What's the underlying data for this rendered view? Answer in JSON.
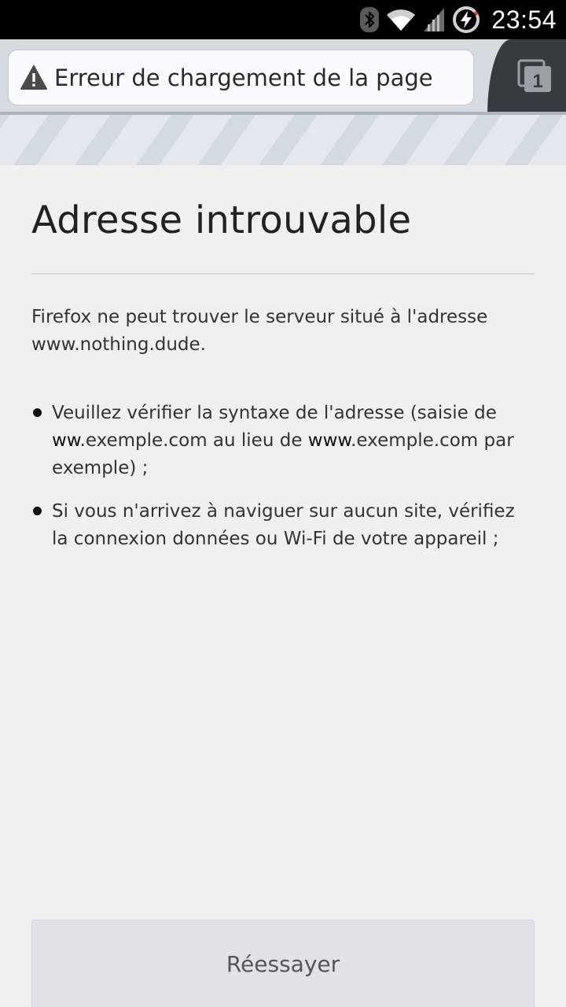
{
  "status_bar": {
    "time": "23:54",
    "icons": [
      "bluetooth-icon",
      "wifi-icon",
      "signal-icon",
      "battery-charging-icon"
    ]
  },
  "toolbar": {
    "page_title": "Erreur de chargement de la page",
    "tab_count": "1"
  },
  "error_page": {
    "title": "Adresse introuvable",
    "message": "Firefox ne peut trouver le serveur situé à l'adresse www.nothing.dude.",
    "hints": [
      {
        "parts": [
          "Veuillez vérifier la syntaxe de l'adresse (saisie de ",
          "ww",
          ".exemple.com au lieu de ",
          "www",
          ".exemple.com par exemple) ;"
        ]
      },
      {
        "parts": [
          "Si vous n'arrivez à naviguer sur aucun site, vérifiez la connexion données ou Wi-Fi de votre appareil ;"
        ]
      }
    ],
    "retry_label": "Réessayer"
  },
  "colors": {
    "status_bar_bg": "#000000",
    "toolbar_bg": "#d6dbe1",
    "tabs_area_bg": "#363b40",
    "page_bg": "#f0f0f0",
    "button_bg": "#e1e2e5"
  }
}
